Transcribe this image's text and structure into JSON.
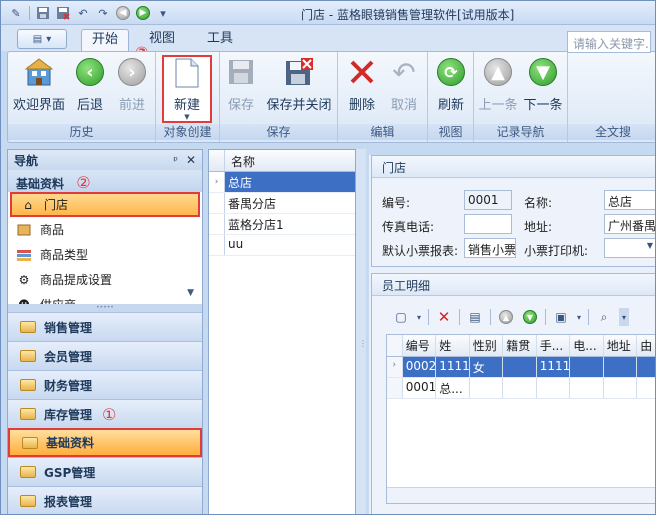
{
  "window": {
    "title": "门店 - 蓝格眼镜销售管理软件[试用版本]"
  },
  "quick_access": [
    "save-icon",
    "save-close-icon",
    "undo-icon",
    "redo-icon",
    "back-icon",
    "forward-icon",
    "dropdown-icon"
  ],
  "ribbon": {
    "tabs": [
      "开始",
      "视图",
      "工具"
    ],
    "active_tab": "开始",
    "groups": {
      "history": {
        "label": "历史",
        "welcome": "欢迎界面",
        "back": "后退",
        "forward": "前进"
      },
      "create": {
        "label": "对象创建",
        "new": "新建"
      },
      "save": {
        "label": "保存",
        "save": "保存",
        "save_close": "保存并关闭"
      },
      "edit": {
        "label": "编辑",
        "delete": "删除",
        "cancel": "取消"
      },
      "view": {
        "label": "视图",
        "refresh": "刷新"
      },
      "record_nav": {
        "label": "记录导航",
        "prev": "上一条",
        "next": "下一条"
      },
      "fulltext": {
        "label": "全文搜",
        "placeholder": "请输入关键字..."
      }
    }
  },
  "markers": {
    "one": "①",
    "two": "②",
    "three": "③"
  },
  "nav": {
    "title": "导航",
    "pin": "ᵖ",
    "close": "✕",
    "section": "基础资料",
    "items": [
      {
        "label": "门店",
        "icon": "home-icon"
      },
      {
        "label": "商品",
        "icon": "goods-icon"
      },
      {
        "label": "商品类型",
        "icon": "goods-type-icon"
      },
      {
        "label": "商品提成设置",
        "icon": "commission-icon"
      },
      {
        "label": "供应商",
        "icon": "supplier-icon"
      }
    ],
    "groups": [
      {
        "label": "销售管理"
      },
      {
        "label": "会员管理"
      },
      {
        "label": "财务管理"
      },
      {
        "label": "库存管理"
      },
      {
        "label": "基础资料"
      },
      {
        "label": "GSP管理"
      },
      {
        "label": "报表管理"
      }
    ]
  },
  "store_list": {
    "column": "名称",
    "rows": [
      "总店",
      "番禺分店",
      "蓝格分店1",
      "uu"
    ]
  },
  "store_detail": {
    "title": "门店",
    "code_label": "编号:",
    "code_value": "0001",
    "name_label": "名称:",
    "name_value": "总店",
    "fax_label": "传真电话:",
    "fax_value": "",
    "addr_label": "地址:",
    "addr_value": "广州番禺",
    "receipt_label": "默认小票报表:",
    "receipt_value": "销售小票",
    "printer_label": "小票打印机:",
    "printer_value": ""
  },
  "employees": {
    "title": "员工明细",
    "columns": [
      "编号",
      "姓",
      "性别",
      "籍贯",
      "手...",
      "电...",
      "地址",
      "由"
    ],
    "rows": [
      [
        "0002",
        "1111",
        "女",
        "",
        "1111",
        "",
        "",
        ""
      ],
      [
        "0001",
        "总...",
        "",
        "",
        "",
        "",
        "",
        ""
      ]
    ]
  }
}
